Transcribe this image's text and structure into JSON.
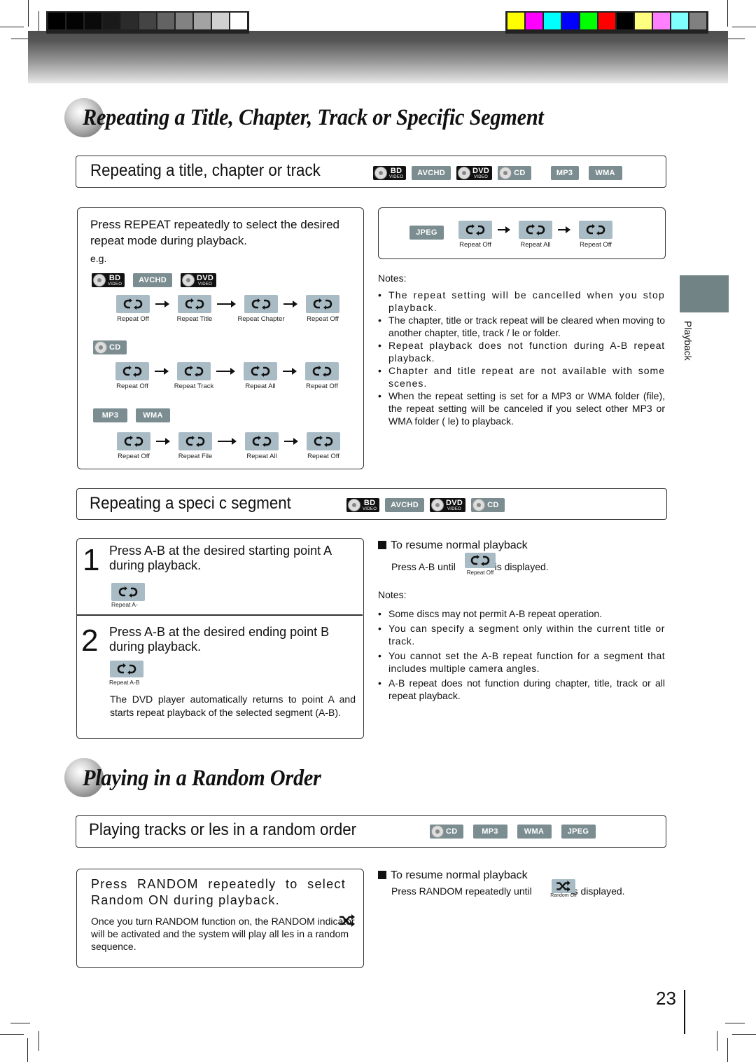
{
  "print_marks": {
    "grayscale_swatches": [
      "#000000",
      "#030303",
      "#0a0a0a",
      "#1a1a1a",
      "#2b2b2b",
      "#444444",
      "#636363",
      "#828282",
      "#a3a3a3",
      "#d0d0d0",
      "#ffffff"
    ],
    "color_swatches": [
      "#ffff00",
      "#ff00ff",
      "#00ffff",
      "#0000ff",
      "#00ff00",
      "#ff0000",
      "#000000",
      "#ffff80",
      "#ff80ff",
      "#80ffff",
      "#808080"
    ]
  },
  "section1": {
    "heading": "Repeating a Title, Chapter, Track or Specific Segment",
    "sub1": {
      "title": "Repeating a title, chapter or track",
      "badges": [
        {
          "name": "bd",
          "label": "BD",
          "sub": "VIDEO",
          "dark": true
        },
        {
          "name": "avchd",
          "label": "AVCHD"
        },
        {
          "name": "dvd",
          "label": "DVD",
          "sub": "VIDEO",
          "dark": true
        },
        {
          "name": "cd",
          "label": "CD",
          "disc": true
        },
        {
          "name": "mp3",
          "label": "MP3"
        },
        {
          "name": "wma",
          "label": "WMA"
        }
      ],
      "instruction": "Press REPEAT repeatedly to select the desired repeat mode during playback.",
      "eg": "e.g.",
      "group1_badges": {
        "bd": "BD",
        "bd_sub": "VIDEO",
        "avchd": "AVCHD",
        "dvd": "DVD",
        "dvd_sub": "VIDEO"
      },
      "group1_modes": [
        "Repeat Off",
        "Repeat Title",
        "Repeat Chapter",
        "Repeat Off"
      ],
      "group2_badge": "CD",
      "group2_modes": [
        "Repeat Off",
        "Repeat Track",
        "Repeat All",
        "Repeat Off"
      ],
      "group3_badges": [
        "MP3",
        "WMA"
      ],
      "group3_modes": [
        "Repeat Off",
        "Repeat File",
        "Repeat All",
        "Repeat Off"
      ],
      "jpeg_badge": "JPEG",
      "jpeg_modes": [
        "Repeat Off",
        "Repeat All",
        "Repeat Off"
      ],
      "notes_title": "Notes:",
      "notes": [
        "The repeat setting will be cancelled when you stop playback.",
        "The chapter, title or track repeat will be cleared when moving to another chapter, title, track /  le or folder.",
        "Repeat playback does not function during A-B repeat playback.",
        "Chapter and title repeat are not available with some scenes.",
        "When the repeat setting is set for a MP3 or WMA folder (file), the repeat setting will be canceled if you select other MP3 or WMA folder ( le) to playback."
      ]
    },
    "sub2": {
      "title": "Repeating a speci c segment",
      "badges": [
        "BD",
        "AVCHD",
        "DVD",
        "CD"
      ],
      "badge_sub": "VIDEO",
      "step1_num": "1",
      "step1_text": "Press A-B at the desired starting point A during playback.",
      "step1_icon_label": "Repeat A-",
      "step2_num": "2",
      "step2_text": "Press A-B at the desired ending point B during playback.",
      "step2_icon_label": "Repeat A-B",
      "step2_note": "The DVD player automatically returns to point A and starts repeat playback of the selected segment (A-B).",
      "resume_title": "To resume normal playback",
      "resume_pre": "Press A-B until",
      "resume_icon_label": "Repeat Off",
      "resume_post": "is displayed.",
      "notes_title": "Notes:",
      "notes": [
        "Some discs may not permit A-B repeat operation.",
        "You can specify a segment only within the current title or track.",
        "You cannot set the A-B repeat function for a segment that includes multiple camera angles.",
        "A-B repeat does not function during chapter, title, track or all repeat playback."
      ]
    }
  },
  "section2": {
    "heading": "Playing in a Random Order",
    "sub": {
      "title": "Playing tracks or  les in a random order",
      "badges": [
        "CD",
        "MP3",
        "WMA",
        "JPEG"
      ],
      "instruction": "Press RANDOM repeatedly to select Random ON during playback.",
      "detail": "Once you turn RANDOM function on, the RANDOM indicator will be activated and the system will play all  les in a random sequence.",
      "resume_title": "To resume normal playback",
      "resume_pre": "Press RANDOM repeatedly until",
      "resume_icon_label": "Random Off",
      "resume_post": "is displayed."
    }
  },
  "side_tab": {
    "label": "Playback",
    "color": "#728386"
  },
  "page_number": "23",
  "colors": {
    "badge": "#7b8d90",
    "icon_bg": "#a9bcc5"
  }
}
